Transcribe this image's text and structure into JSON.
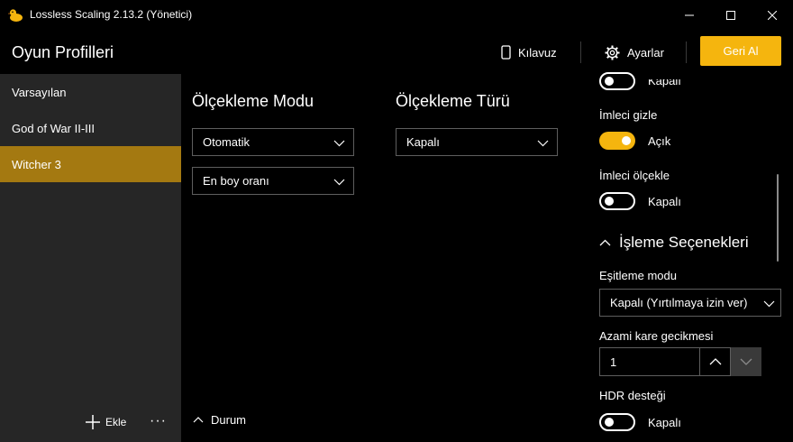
{
  "window": {
    "title": "Lossless Scaling 2.13.2 (Yönetici)",
    "accent_color": "#f5b50e",
    "selected_color": "#a47911"
  },
  "header": {
    "title": "Oyun Profilleri",
    "guide_label": "Kılavuz",
    "settings_label": "Ayarlar",
    "apply_label": "Geri Al"
  },
  "sidebar": {
    "items": [
      {
        "label": "Varsayılan"
      },
      {
        "label": "God of War II-III"
      },
      {
        "label": "Witcher 3"
      }
    ],
    "selected_index": 2,
    "add_label": "Ekle",
    "more_label": "···"
  },
  "main": {
    "scaling_mode": {
      "title": "Ölçekleme Modu",
      "dropdown1_value": "Otomatik",
      "dropdown2_value": "En boy oranı"
    },
    "scaling_type": {
      "title": "Ölçekleme Türü",
      "dropdown_value": "Kapalı"
    },
    "status_label": "Durum"
  },
  "right_panel": {
    "partial_toggle_text": "Kapalı",
    "hide_cursor": {
      "label": "İmleci gizle",
      "state_text": "Açık",
      "on": true
    },
    "scale_cursor": {
      "label": "İmleci ölçekle",
      "state_text": "Kapalı",
      "on": false
    },
    "section_title": "İşleme Seçenekleri",
    "sync_mode": {
      "label": "Eşitleme modu",
      "value": "Kapalı (Yırtılmaya izin ver)"
    },
    "max_frame_latency": {
      "label": "Azami kare gecikmesi",
      "value": "1"
    },
    "hdr_support": {
      "label": "HDR desteği",
      "state_text": "Kapalı",
      "on": false
    }
  }
}
